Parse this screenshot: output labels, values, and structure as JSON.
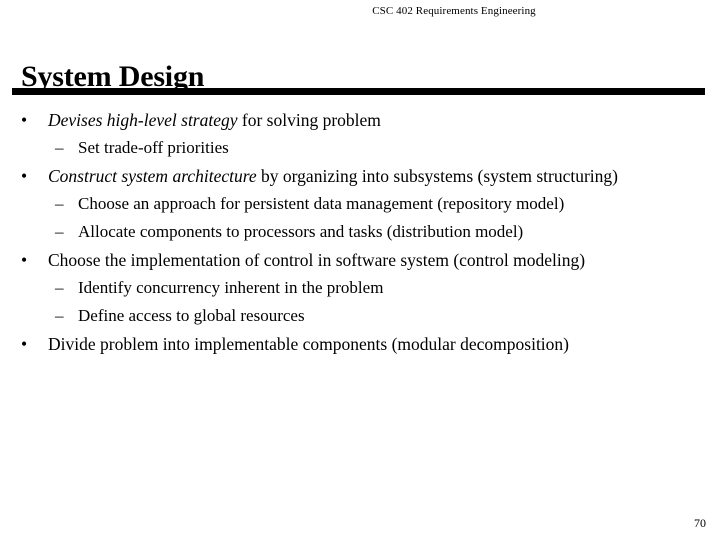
{
  "header": {
    "course_line": "CSC 402 Requirements Engineering"
  },
  "title": {
    "text": "System Design"
  },
  "page": {
    "number": "70"
  },
  "markers": {
    "level1": "•",
    "level2": "–"
  },
  "body": {
    "items": [
      {
        "level": 1,
        "italic_lead": "Devises high-level strategy",
        "text": " for solving problem"
      },
      {
        "level": 2,
        "italic_lead": "",
        "text": "Set trade-off priorities"
      },
      {
        "level": 1,
        "italic_lead": "Construct system architecture",
        "text": " by organizing into subsystems (system structuring)"
      },
      {
        "level": 2,
        "italic_lead": "",
        "text": "Choose an approach for persistent data management (repository model)"
      },
      {
        "level": 2,
        "italic_lead": "",
        "text": "Allocate components to processors and tasks (distribution model)"
      },
      {
        "level": 1,
        "italic_lead": "",
        "text": "Choose the implementation of control in software system (control modeling)"
      },
      {
        "level": 2,
        "italic_lead": "",
        "text": "Identify concurrency inherent in the problem"
      },
      {
        "level": 2,
        "italic_lead": "",
        "text": "Define access to global resources"
      },
      {
        "level": 1,
        "italic_lead": "",
        "text": "Divide problem into implementable components  (modular decomposition)"
      }
    ]
  }
}
